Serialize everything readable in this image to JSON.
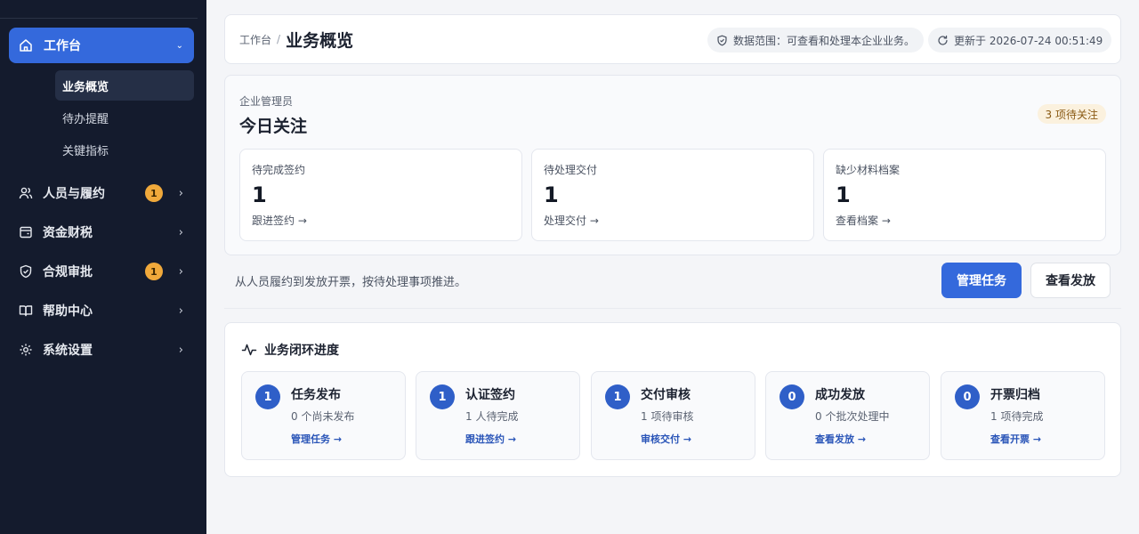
{
  "sidebar": {
    "main_item": {
      "label": "工作台",
      "icon": "home-icon",
      "chevron": "⌄"
    },
    "sub_items": [
      {
        "label": "业务概览"
      },
      {
        "label": "待办提醒"
      },
      {
        "label": "关键指标"
      }
    ],
    "items": [
      {
        "label": "人员与履约",
        "icon": "users-icon",
        "badge": "1",
        "chevron": "›"
      },
      {
        "label": "资金财税",
        "icon": "wallet-icon",
        "badge": "",
        "chevron": "›"
      },
      {
        "label": "合规审批",
        "icon": "shield-icon",
        "badge": "1",
        "chevron": "›"
      },
      {
        "label": "帮助中心",
        "icon": "book-icon",
        "badge": "",
        "chevron": "›"
      },
      {
        "label": "系统设置",
        "icon": "gear-icon",
        "badge": "",
        "chevron": "›"
      }
    ]
  },
  "header": {
    "breadcrumb_root": "工作台",
    "breadcrumb_sep": "/",
    "title": "业务概览",
    "scope": "数据范围：可查看和处理本企业业务。",
    "updated": "更新于 2026-07-24 00:51:49"
  },
  "focus": {
    "role": "企业管理员",
    "title": "今日关注",
    "pending": "3 项待关注",
    "stats": [
      {
        "label": "待完成签约",
        "value": "1",
        "link": "跟进签约 →"
      },
      {
        "label": "待处理交付",
        "value": "1",
        "link": "处理交付 →"
      },
      {
        "label": "缺少材料档案",
        "value": "1",
        "link": "查看档案 →"
      }
    ]
  },
  "actions": {
    "hint": "从人员履约到发放开票，按待处理事项推进。",
    "primary": "管理任务",
    "secondary": "查看发放"
  },
  "progress": {
    "title": "业务闭环进度",
    "steps": [
      {
        "num": "1",
        "name": "任务发布",
        "desc": "0 个尚未发布",
        "action": "管理任务 →"
      },
      {
        "num": "1",
        "name": "认证签约",
        "desc": "1 人待完成",
        "action": "跟进签约 →"
      },
      {
        "num": "1",
        "name": "交付审核",
        "desc": "1 项待审核",
        "action": "审核交付 →"
      },
      {
        "num": "0",
        "name": "成功发放",
        "desc": "0 个批次处理中",
        "action": "查看发放 →"
      },
      {
        "num": "0",
        "name": "开票归档",
        "desc": "1 项待完成",
        "action": "查看开票 →"
      }
    ]
  },
  "colors": {
    "accent": "#3469dc",
    "sidebar_bg": "#141b2d",
    "badge": "#f0a93b"
  }
}
